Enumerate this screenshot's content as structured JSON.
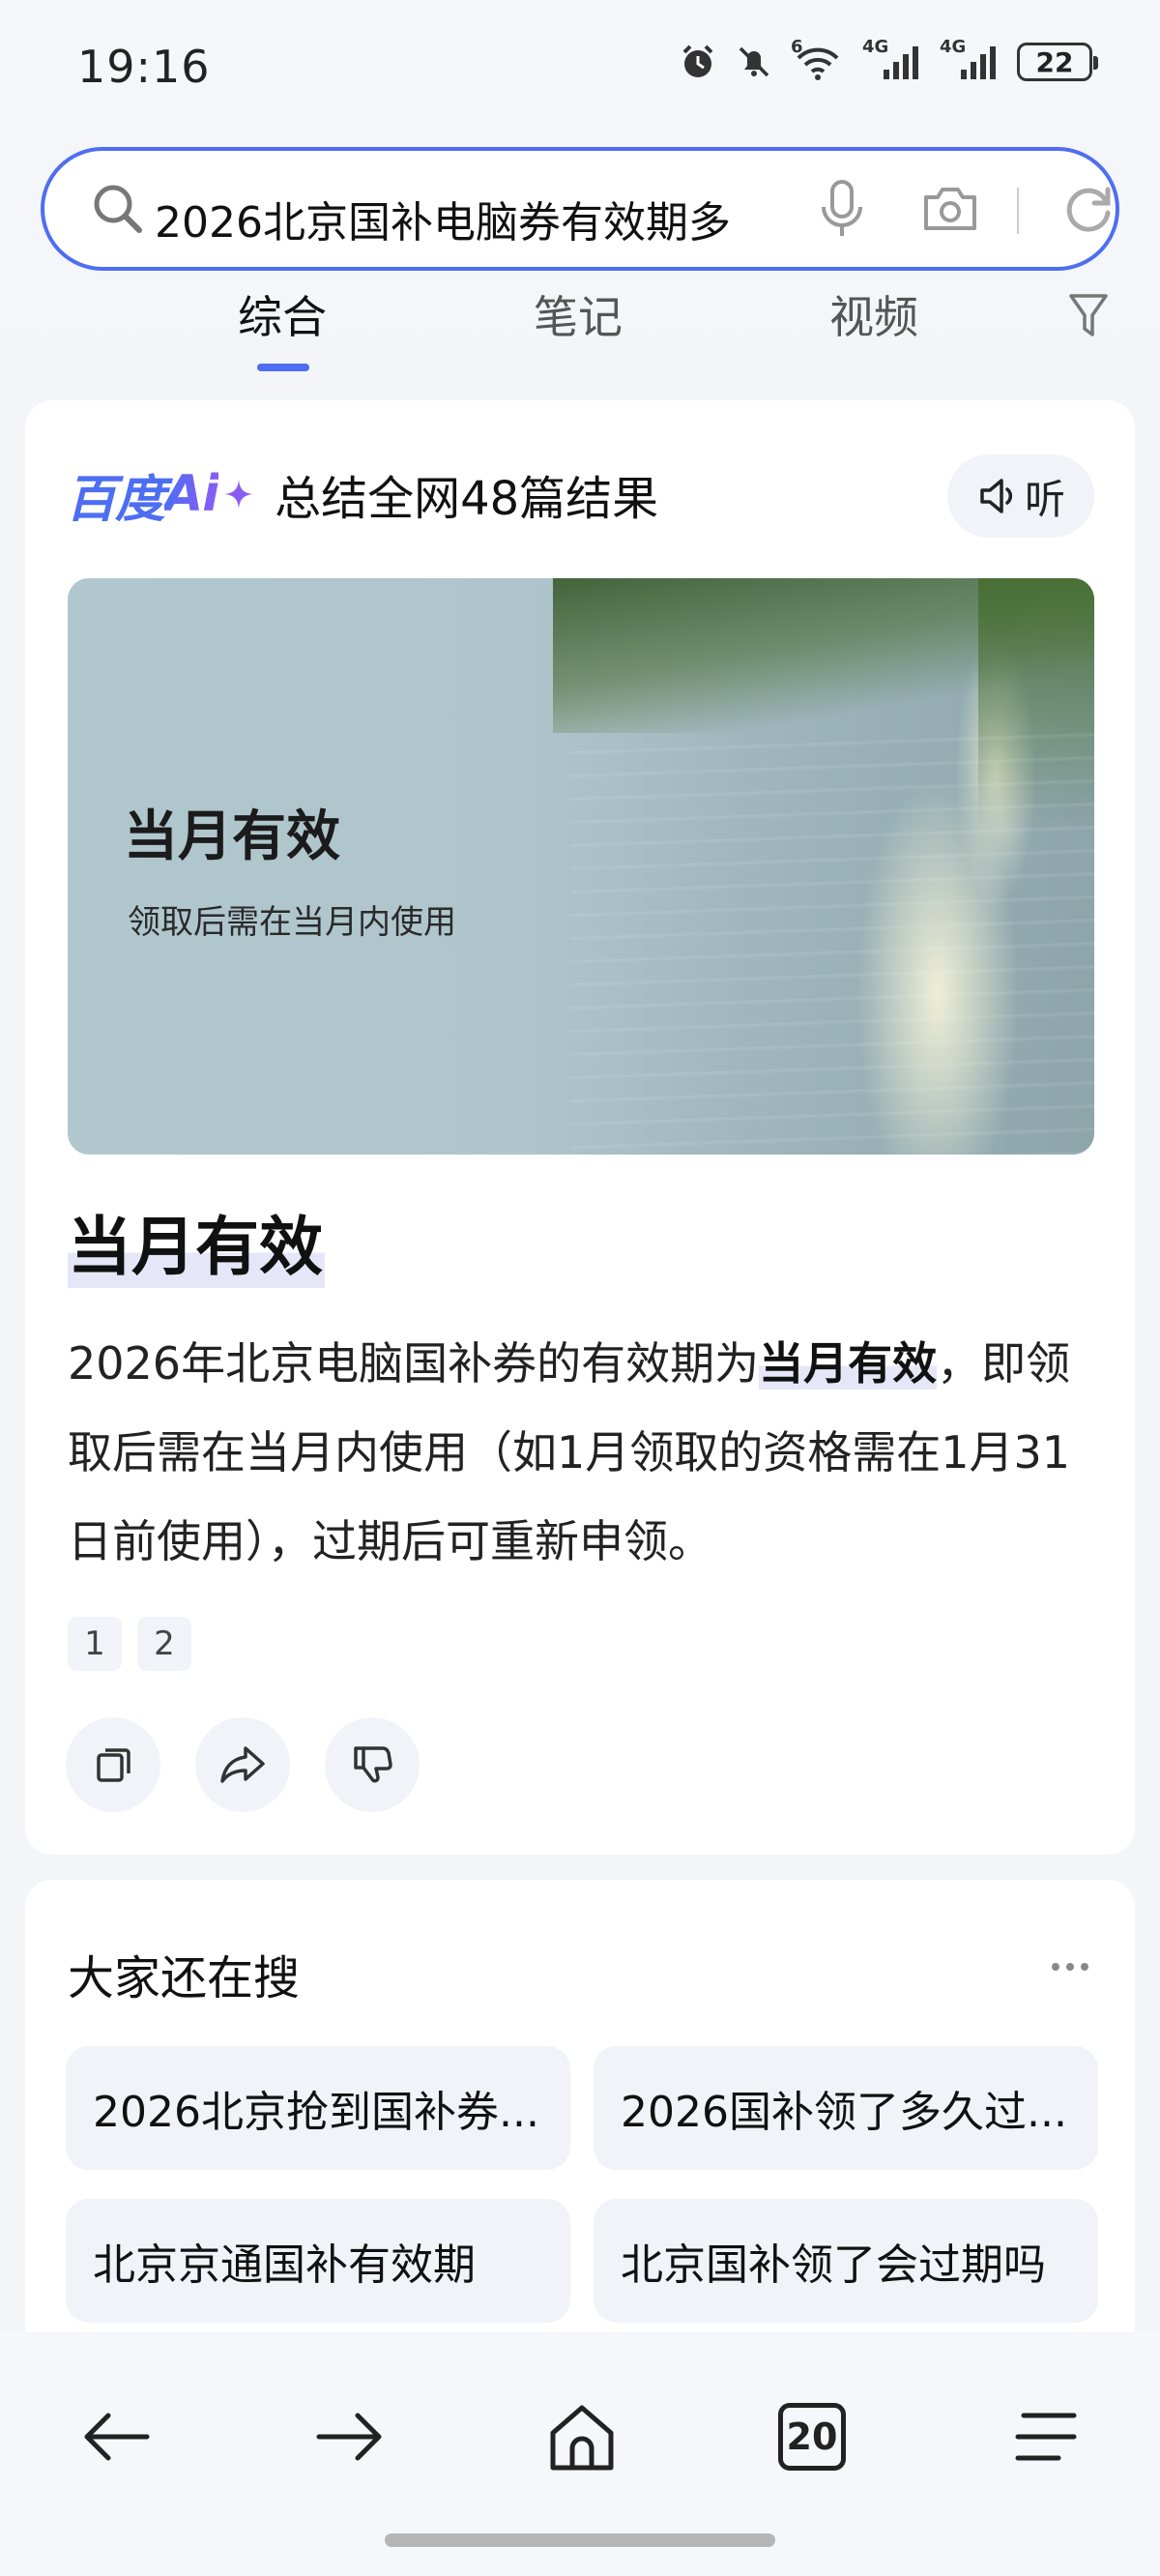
{
  "status_bar": {
    "time": "19:16",
    "net1": "6",
    "net2": "4G",
    "net3": "4G",
    "battery": "22"
  },
  "search": {
    "query": "2026北京国补电脑券有效期多"
  },
  "tabs": [
    {
      "label": "综合",
      "active": true
    },
    {
      "label": "笔记",
      "active": false
    },
    {
      "label": "视频",
      "active": false
    }
  ],
  "ai_card": {
    "logo_prefix": "百度",
    "logo_ai": "Ai",
    "summary": "总结全网48篇结果",
    "listen_label": "听",
    "hero_title": "当月有效",
    "hero_subtitle": "领取后需在当月内使用",
    "answer_title": "当月有效",
    "answer_part1": "2026年北京电脑国补券的有效期为",
    "answer_highlight": "当月有效",
    "answer_part2": "，即领取后需在当月内使用（如1月领取的资格需在1月31日前使用），过期后可重新申领。",
    "refs": [
      "1",
      "2"
    ]
  },
  "related": {
    "title": "大家还在搜",
    "items": [
      "2026北京抢到国补券...",
      "2026国补领了多久过...",
      "北京京通国补有效期",
      "北京国补领了会过期吗"
    ]
  },
  "bottom_nav": {
    "tab_count": "20"
  },
  "colors": {
    "accent": "#4e6ef2",
    "ai_gradient_end": "#8a5cf6",
    "chip_bg": "#f1f3f8"
  }
}
